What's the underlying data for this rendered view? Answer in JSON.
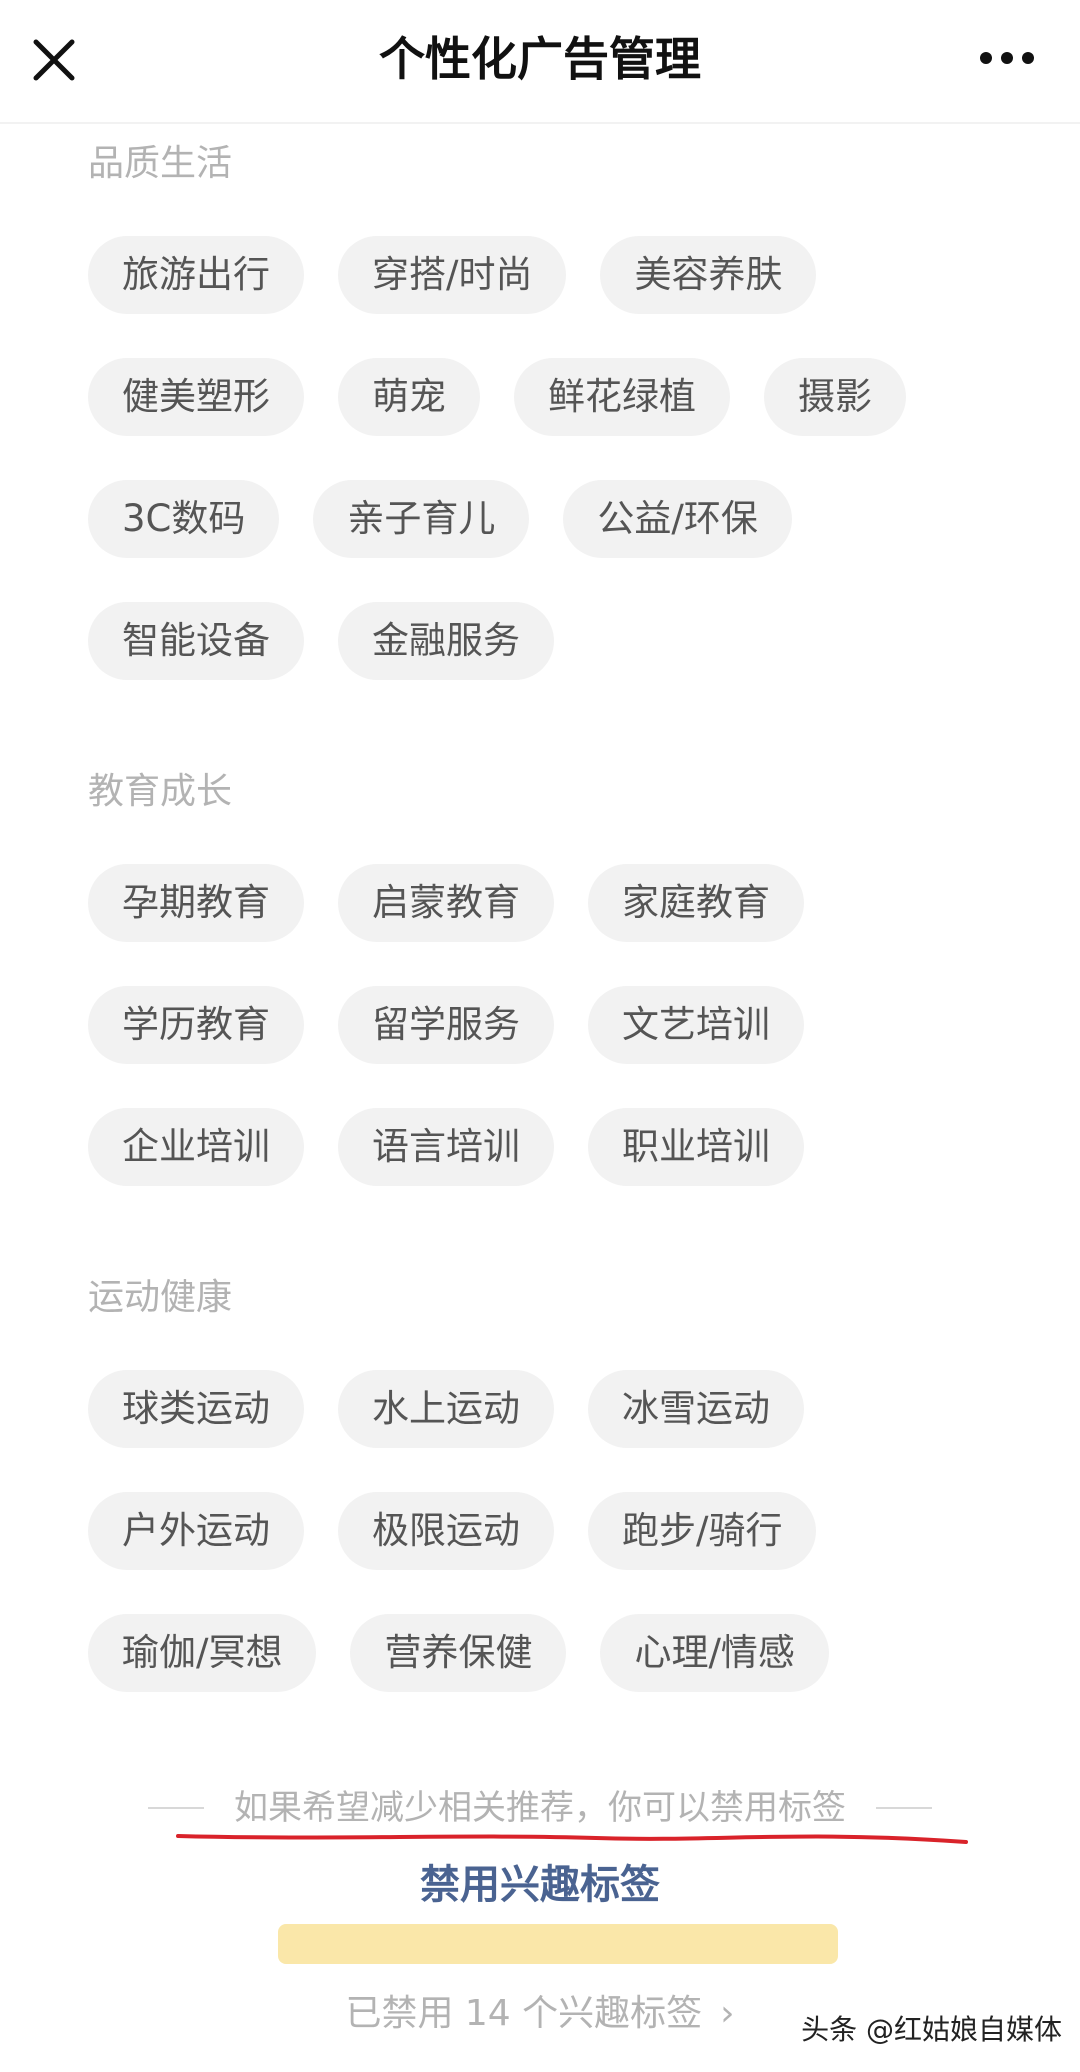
{
  "header": {
    "title": "个性化广告管理"
  },
  "sections": [
    {
      "title": "品质生活",
      "rows": [
        [
          "旅游出行",
          "穿搭/时尚",
          "美容养肤"
        ],
        [
          "健美塑形",
          "萌宠",
          "鲜花绿植",
          "摄影"
        ],
        [
          "3C数码",
          "亲子育儿",
          "公益/环保"
        ],
        [
          "智能设备",
          "金融服务"
        ]
      ]
    },
    {
      "title": "教育成长",
      "rows": [
        [
          "孕期教育",
          "启蒙教育",
          "家庭教育"
        ],
        [
          "学历教育",
          "留学服务",
          "文艺培训"
        ],
        [
          "企业培训",
          "语言培训",
          "职业培训"
        ]
      ]
    },
    {
      "title": "运动健康",
      "rows": [
        [
          "球类运动",
          "水上运动",
          "冰雪运动"
        ],
        [
          "户外运动",
          "极限运动",
          "跑步/骑行"
        ],
        [
          "瑜伽/冥想",
          "营养保健",
          "心理/情感"
        ]
      ]
    }
  ],
  "footer": {
    "hint": "如果希望减少相关推荐，你可以禁用标签",
    "disable_label": "禁用兴趣标签",
    "disabled_count": "已禁用 14 个兴趣标签"
  },
  "watermark": "头条 @红姑娘自媒体",
  "colors": {
    "link": "#4a6391",
    "tag_bg": "#f2f2f2",
    "annotation_red": "#d9232a",
    "annotation_yellow": "#f9e39a"
  }
}
